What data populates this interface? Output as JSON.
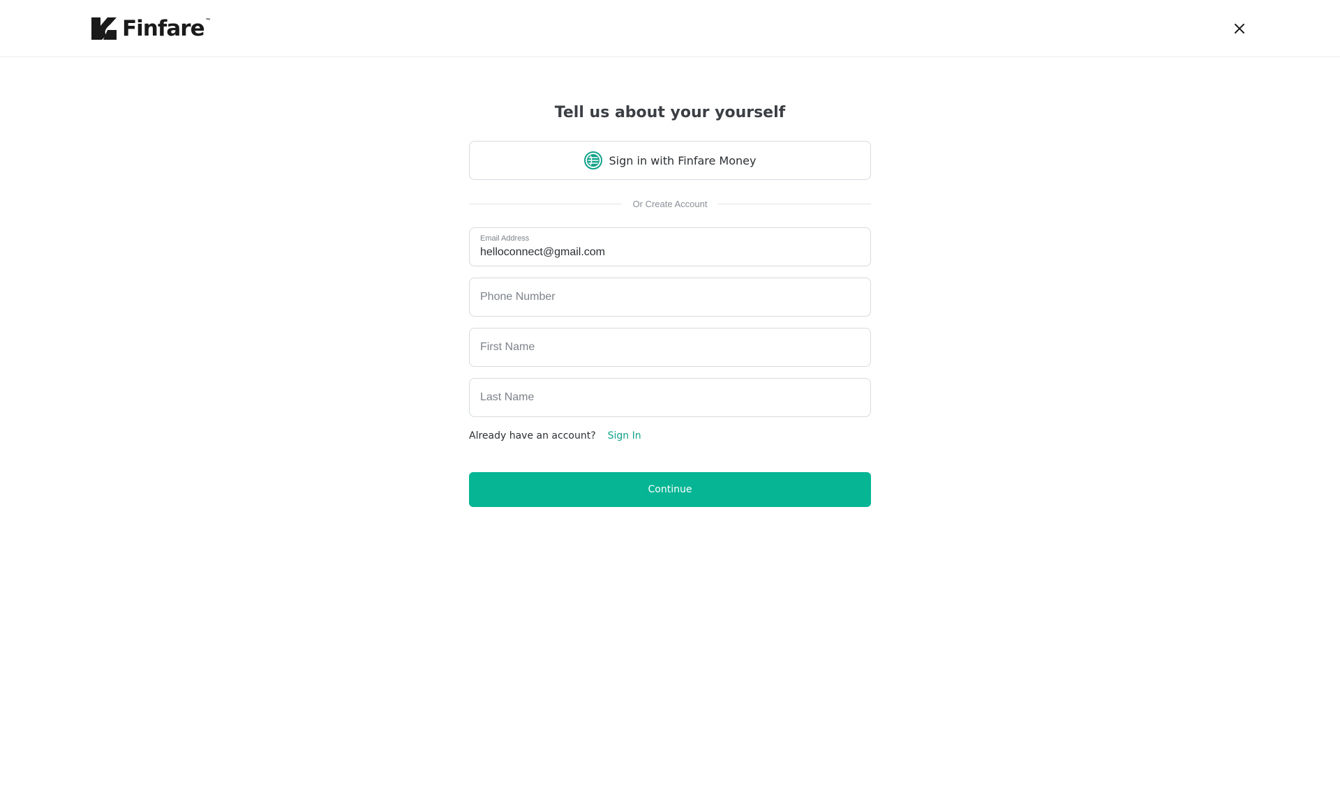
{
  "header": {
    "logo_text": "Finfare",
    "logo_tm": "™",
    "close_icon": "close-icon"
  },
  "form": {
    "title": "Tell us about your yourself",
    "sso_button": {
      "label": "Sign in with Finfare Money",
      "icon": "finfare-money-icon"
    },
    "divider_text": "Or Create Account",
    "fields": {
      "email": {
        "label": "Email Address",
        "value": "helloconnect@gmail.com"
      },
      "phone": {
        "placeholder": "Phone Number",
        "value": ""
      },
      "first_name": {
        "placeholder": "First Name",
        "value": ""
      },
      "last_name": {
        "placeholder": "Last Name",
        "value": ""
      }
    },
    "signin_prompt": "Already have an account?",
    "signin_link": "Sign In",
    "continue_label": "Continue"
  },
  "colors": {
    "accent": "#05b594",
    "link": "#12a28a",
    "border": "#d6d9dd",
    "text": "#2b2f33"
  }
}
